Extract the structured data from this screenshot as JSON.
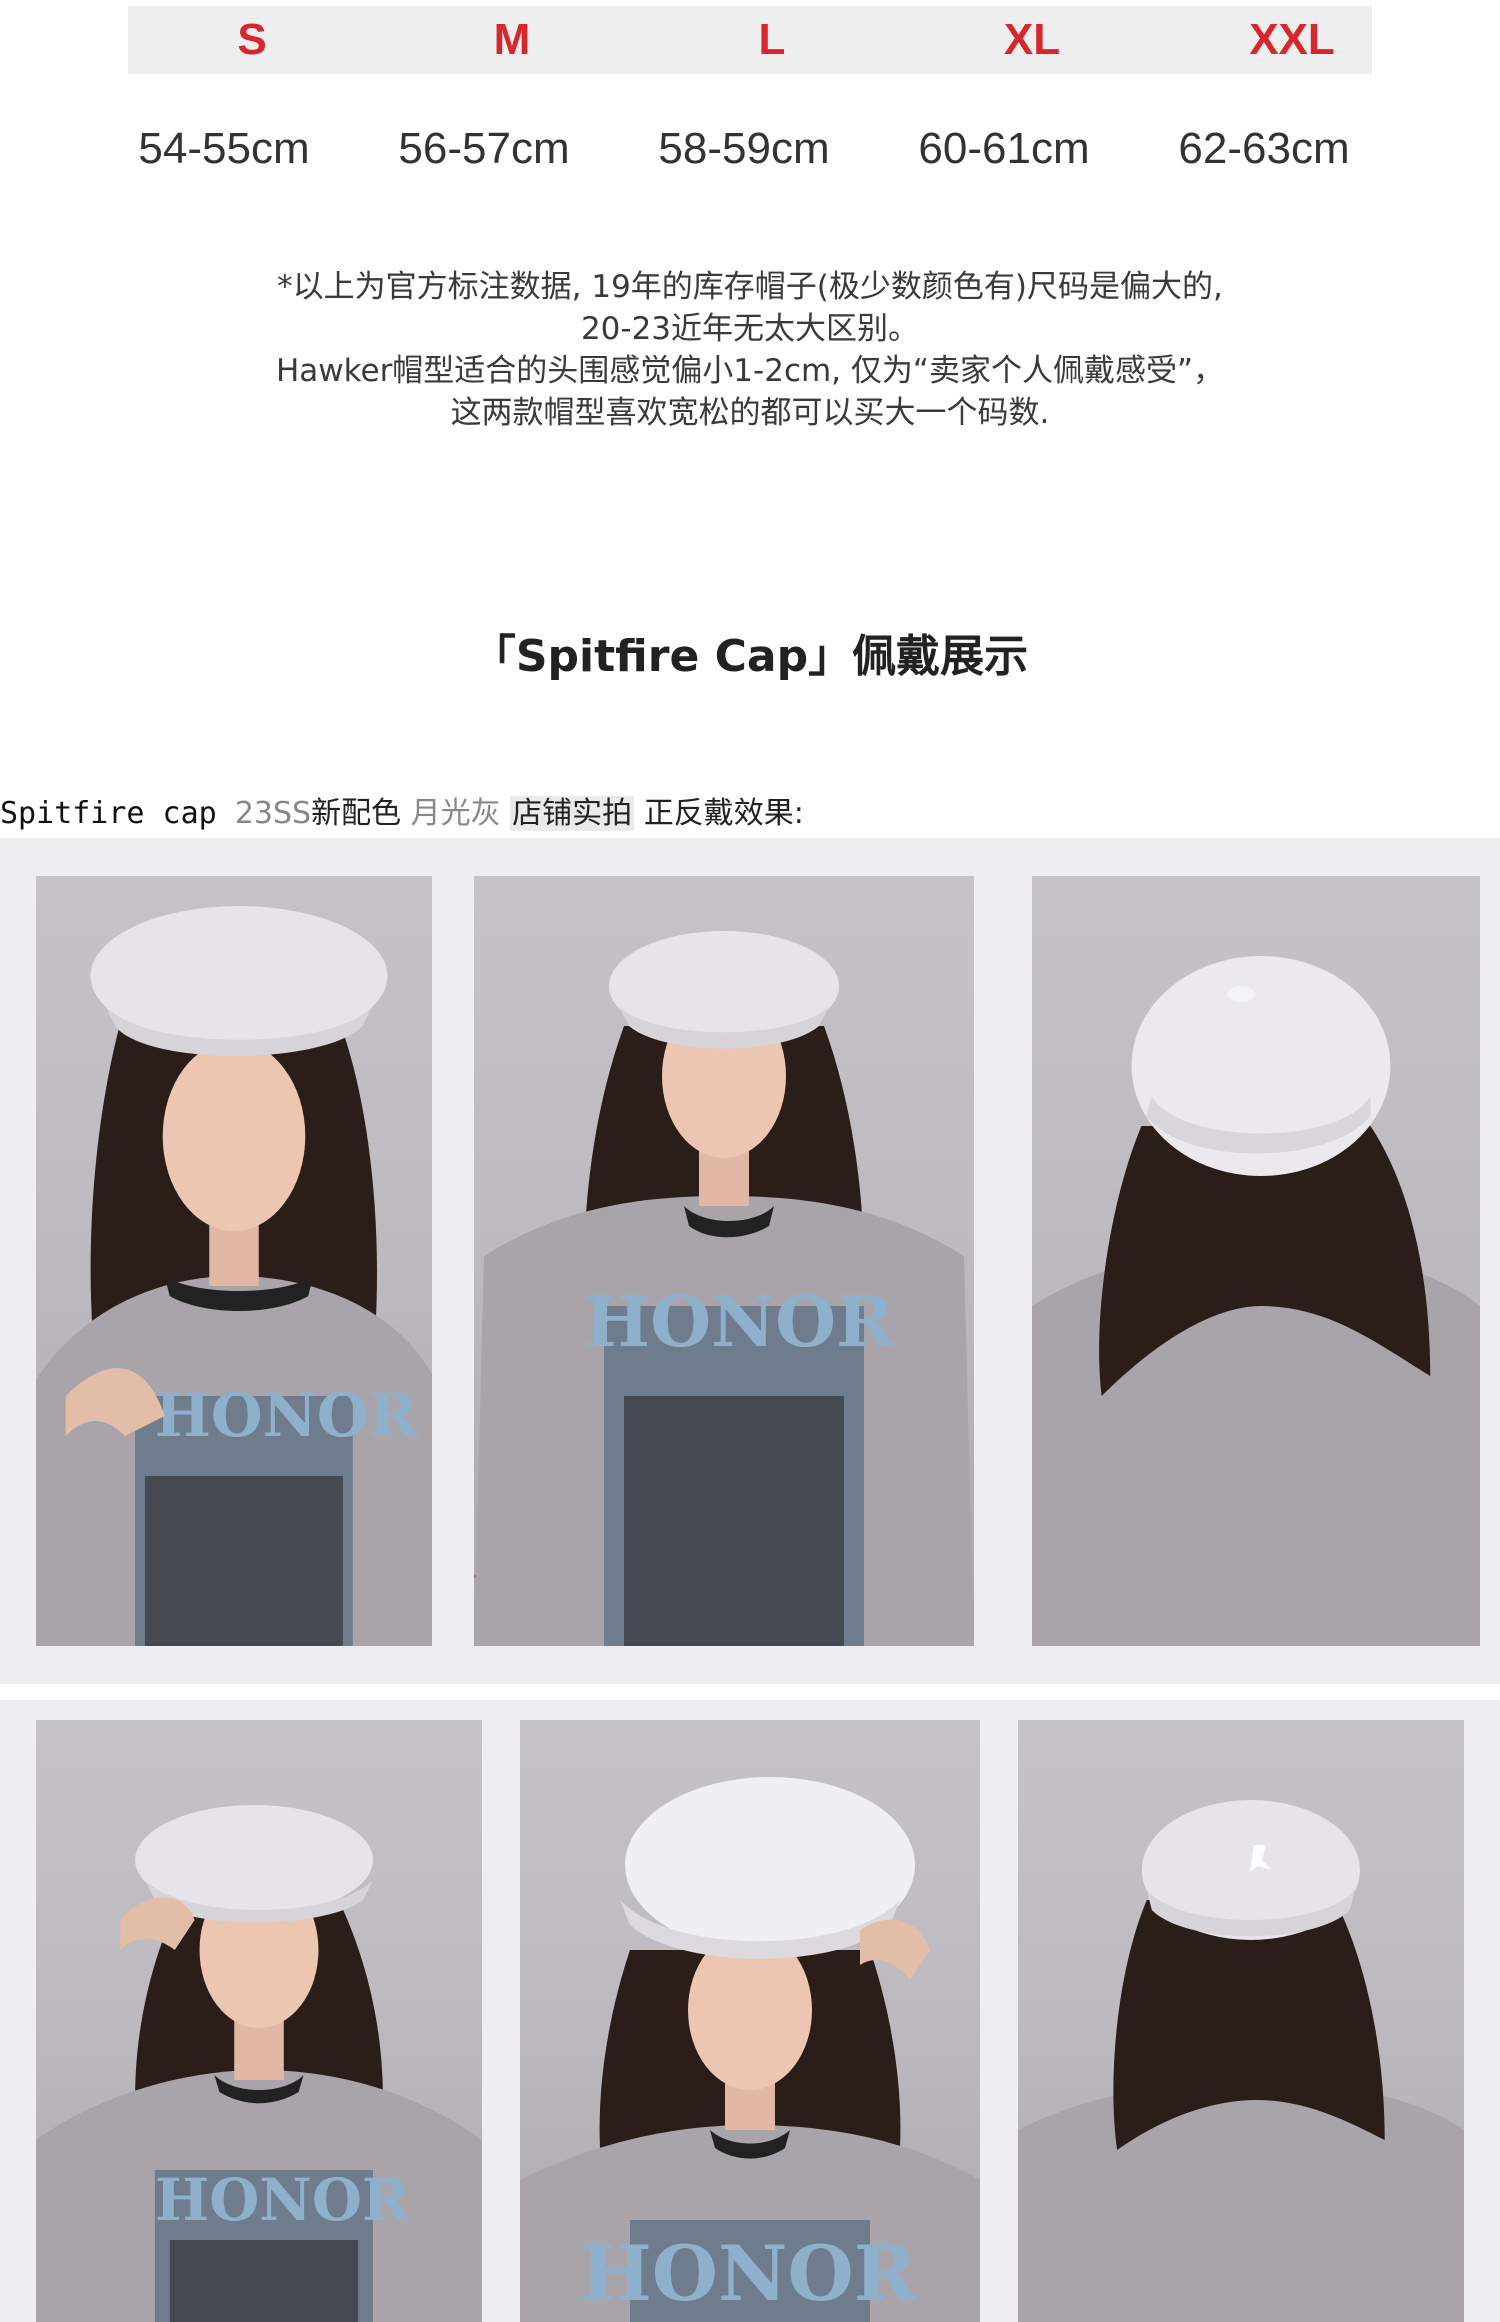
{
  "size_chart": {
    "sizes": [
      "S",
      "M",
      "L",
      "XL",
      "XXL"
    ],
    "circumferences": [
      "54-55cm",
      "56-57cm",
      "58-59cm",
      "60-61cm",
      "62-63cm"
    ],
    "size_color": "#d9262c"
  },
  "notes": [
    "*以上为官方标注数据, 19年的库存帽子(极少数颜色有)尺码是偏大的,",
    "20-23近年无太大区别。",
    "Hawker帽型适合的头围感觉偏小1-2cm, 仅为“卖家个人佩戴感受”，",
    "这两款帽型喜欢宽松的都可以买大一个码数."
  ],
  "section_title": "「Spitfire Cap」佩戴展示",
  "caption": {
    "part1": "Spitfire  cap ",
    "part2": "23SS",
    "part3": "新配色 ",
    "part4": "月光灰",
    "part5": " ",
    "part6": "店铺实拍",
    "part7": " ",
    "part8": "正反戴效果:"
  },
  "photos": [
    {
      "view": "front",
      "pose": "hand-on-collar"
    },
    {
      "view": "front",
      "pose": "arms-down"
    },
    {
      "view": "back",
      "pose": "standing"
    },
    {
      "view": "front",
      "pose": "hand-on-brim"
    },
    {
      "view": "front",
      "pose": "looking-down"
    },
    {
      "view": "back",
      "pose": "standing"
    }
  ],
  "colors": {
    "hat": "#e6e4e8",
    "shirt": "#a8a4aa",
    "hair": "#2b1d17",
    "print": "#7e99b4"
  }
}
